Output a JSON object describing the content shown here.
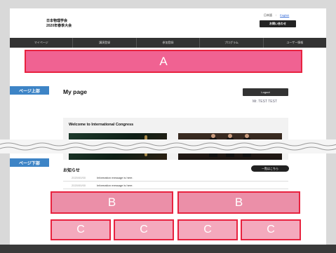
{
  "header": {
    "site_title_line1": "日本物理学会",
    "site_title_line2": "2020年春季大会",
    "lang_ja": "日本語",
    "lang_separator": "/",
    "lang_en": "English",
    "contact_label": "お問い合わせ"
  },
  "nav": {
    "items": [
      "マイページ",
      "講演登録",
      "参加登録",
      "プログラム",
      "ユーザー情報"
    ]
  },
  "annotations": {
    "a": "A",
    "b": "B",
    "c": "C"
  },
  "tags": {
    "top": "ページ上部",
    "bottom": "ページ下部"
  },
  "mypage": {
    "title": "My page",
    "logout_label": "Logout",
    "user_name": "Mr. TEST TEST"
  },
  "welcome": {
    "title": "Welcome to International Congress"
  },
  "notices": {
    "title": "お知らせ",
    "list_button": "一覧はこちら",
    "items": [
      {
        "date": "2020/00/00",
        "message": "Information message is here."
      },
      {
        "date": "2020/00/00",
        "message": "Information message is here."
      }
    ]
  },
  "colors": {
    "annotation_border": "#e8223f",
    "annotation_a": "#f06292",
    "annotation_b": "#eb8fa8",
    "annotation_c": "#f4a9bd",
    "tag_blue": "#3d84c6",
    "nav_bg": "#333333"
  }
}
